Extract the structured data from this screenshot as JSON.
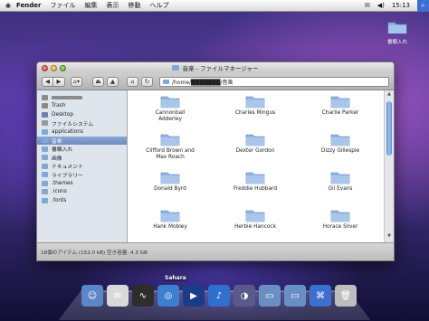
{
  "menubar": {
    "app_name": "Fender",
    "menus": [
      "ファイル",
      "編集",
      "表示",
      "移動",
      "ヘルプ"
    ],
    "clock": "15:13"
  },
  "desktop": {
    "icon_label": "書類入れ"
  },
  "window": {
    "title": "音楽 - ファイルマネージャー",
    "path": "/home/███████/音楽",
    "sidebar": [
      {
        "label": "",
        "icon": "home-icon",
        "color": "#8b8b8b"
      },
      {
        "label": "Trash",
        "icon": "trash-icon",
        "color": "#8a8a8a"
      },
      {
        "label": "Desktop",
        "icon": "desktop-icon",
        "color": "#6f7fae"
      },
      {
        "label": "ファイルシステム",
        "icon": "drive-icon",
        "color": "#9a9a9a"
      },
      {
        "label": "applications",
        "icon": "folder-icon",
        "color": "#7fa9d8"
      },
      {
        "label": "音楽",
        "icon": "folder-icon",
        "color": "#7fa9d8",
        "selected": true
      },
      {
        "label": "書類入れ",
        "icon": "folder-icon",
        "color": "#7fa9d8"
      },
      {
        "label": "画像",
        "icon": "folder-icon",
        "color": "#7fa9d8"
      },
      {
        "label": "ドキュメント",
        "icon": "folder-icon",
        "color": "#7fa9d8"
      },
      {
        "label": "ライブラリー",
        "icon": "folder-icon",
        "color": "#7fa9d8"
      },
      {
        "label": ".themes",
        "icon": "folder-icon",
        "color": "#7fa9d8"
      },
      {
        "label": ".icons",
        "icon": "folder-icon",
        "color": "#7fa9d8"
      },
      {
        "label": ".fonts",
        "icon": "folder-icon",
        "color": "#7fa9d8"
      }
    ],
    "folders": [
      "Cannonball Adderley",
      "Charles Mingus",
      "Charlie Parker",
      "Clifford Brown and Max Roach",
      "Dexter Gordon",
      "Dizzy Gillespie",
      "Donald Byrd",
      "Freddie Hubbard",
      "Gil Evans",
      "Hank Mobley",
      "Herbie Hancock",
      "Horace Silver"
    ],
    "status": "18個のアイテム (152.0 kB) 空き容量: 4.3 GB"
  },
  "dock": {
    "active_label": "Sahara",
    "items": [
      {
        "icon": "finder-icon",
        "color": "#5b86c9"
      },
      {
        "icon": "mail-icon",
        "color": "#d9d9d9"
      },
      {
        "icon": "monitor-icon",
        "color": "#2d2d2d"
      },
      {
        "icon": "browser-icon",
        "color": "#3a7fd0"
      },
      {
        "icon": "movie-icon",
        "color": "#1a3b8a"
      },
      {
        "icon": "music-icon",
        "color": "#2f6fcf"
      },
      {
        "icon": "widget-icon",
        "color": "#5a5a8a"
      },
      {
        "icon": "folder-icon",
        "color": "#6a8fc4"
      },
      {
        "icon": "folder-icon",
        "color": "#6a8fc4"
      },
      {
        "icon": "network-icon",
        "color": "#3b6fd1"
      },
      {
        "icon": "trash-icon",
        "color": "#bdbdbd"
      }
    ]
  }
}
